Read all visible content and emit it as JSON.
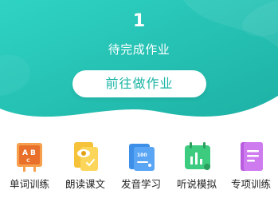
{
  "homework": {
    "count": "1",
    "status_text": "待完成作业",
    "cta_label": "前往做作业"
  },
  "features": [
    {
      "label": "单词训练",
      "icon": "abc-board-icon"
    },
    {
      "label": "朗读课文",
      "icon": "reading-eye-icon"
    },
    {
      "label": "发音学习",
      "icon": "pronunciation-card-icon"
    },
    {
      "label": "听说模拟",
      "icon": "listening-chart-icon"
    },
    {
      "label": "专项训练",
      "icon": "notebook-icon"
    }
  ],
  "colors": {
    "hero_start": "#2fd3c4",
    "hero_end": "#1fb5a8",
    "cta_text": "#1cb5a6"
  }
}
